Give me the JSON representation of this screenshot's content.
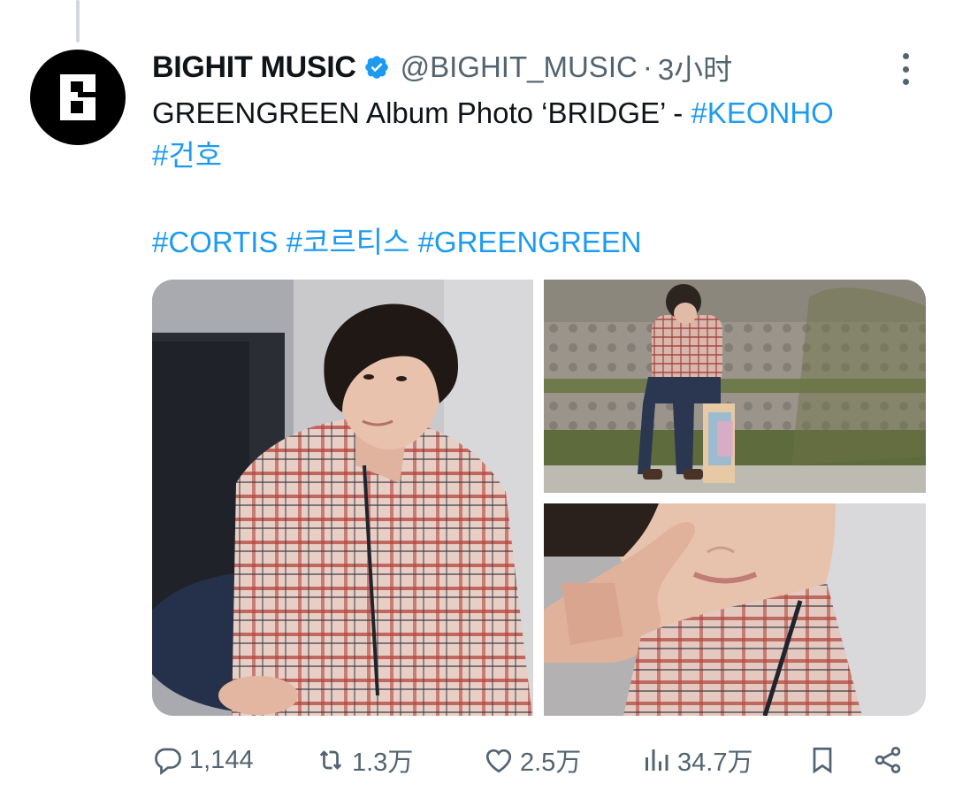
{
  "tweet": {
    "display_name": "BIGHIT MUSIC",
    "handle": "@BIGHIT_MUSIC",
    "separator": "·",
    "time": "3小时",
    "text_line1_plain": "GREENGREEN Album Photo ‘BRIDGE’ - ",
    "text_line1_tag": "#KEONHO",
    "text_line2_tag": "#건호",
    "tags_line3": [
      "#CORTIS",
      "#코르티스",
      "#GREENGREEN"
    ]
  },
  "media": {
    "photos": [
      {
        "alt": "Photo of KEONHO in plaid jacket leaning against a wall"
      },
      {
        "alt": "Photo of KEONHO sitting in front of a stone retaining wall"
      },
      {
        "alt": "Close-up photo of KEONHO touching his face"
      }
    ]
  },
  "actions": {
    "reply_count": "1,144",
    "retweet_count": "1.3万",
    "like_count": "2.5万",
    "views_count": "34.7万"
  },
  "icons": {
    "verified": "verified-badge-icon",
    "more": "more-options-icon",
    "reply": "reply-icon",
    "retweet": "retweet-icon",
    "like": "heart-icon",
    "views": "views-chart-icon",
    "bookmark": "bookmark-icon",
    "share": "share-icon"
  },
  "colors": {
    "accent": "#1d9bf0",
    "secondary_text": "#536471",
    "primary_text": "#0f1419"
  }
}
